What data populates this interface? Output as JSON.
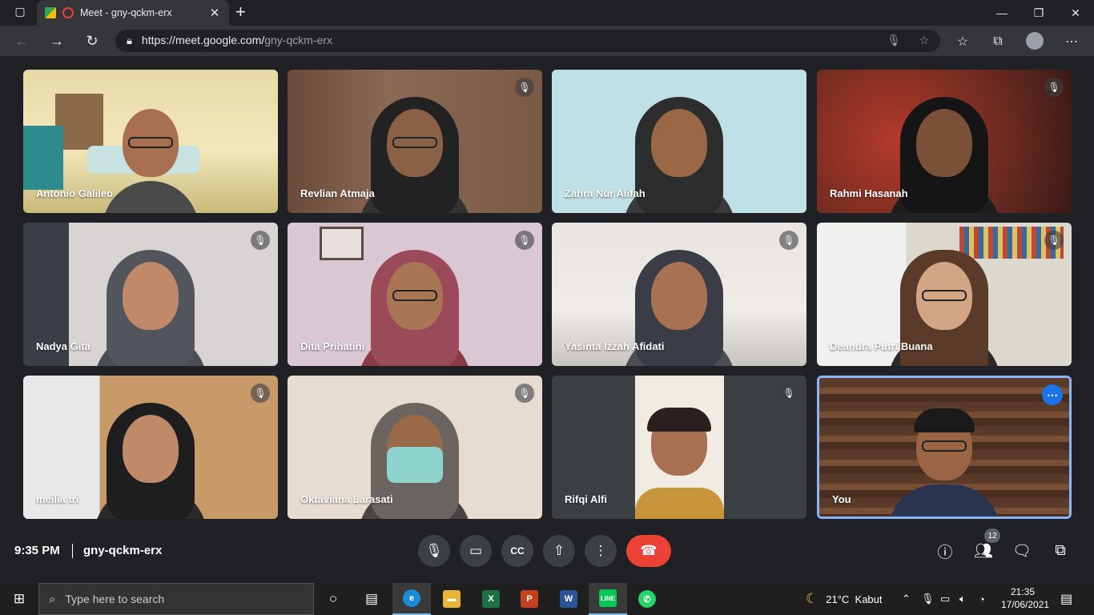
{
  "browser": {
    "tab_title": "Meet - gny-qckm-erx",
    "url_host": "https://meet.google.com/",
    "url_path": "gny-qckm-erx"
  },
  "participants": [
    {
      "name": "Antonio Galileo",
      "muted": false,
      "background": "illustrated-living-room"
    },
    {
      "name": "Revlian Atmaja",
      "muted": true,
      "background": "indoor-dark"
    },
    {
      "name": "Zahra Nur Alifah",
      "muted": false,
      "background": "light-blue-wall"
    },
    {
      "name": "Rahmi Hasanah",
      "muted": true,
      "background": "floral-sofa"
    },
    {
      "name": "Nadya Gita",
      "muted": true,
      "background": "grey-room"
    },
    {
      "name": "Dita Prihatini",
      "muted": true,
      "background": "pink-wall"
    },
    {
      "name": "Yasinta Izzah Afidati",
      "muted": true,
      "background": "white-kitchen"
    },
    {
      "name": "Deandra Putri Buana",
      "muted": true,
      "background": "bookshelf"
    },
    {
      "name": "meilia tri",
      "muted": true,
      "background": "wood-kitchen"
    },
    {
      "name": "Oktaviana Larasati",
      "muted": true,
      "background": "plain-wall"
    },
    {
      "name": "Rifqi Alfi",
      "muted": true,
      "background": "portrait-video"
    },
    {
      "name": "You",
      "muted": false,
      "background": "masterchef-studio"
    }
  ],
  "meeting": {
    "time": "9:35 PM",
    "code": "gny-qckm-erx",
    "people_count": "12"
  },
  "taskbar": {
    "search_placeholder": "Type here to search",
    "weather": "21°C  Kabut",
    "time": "21:35",
    "date": "17/06/2021"
  },
  "colors": {
    "meet_bg": "#202124",
    "end_call": "#ea4335",
    "active_border": "#8ab4f8",
    "accent": "#1a73e8"
  }
}
